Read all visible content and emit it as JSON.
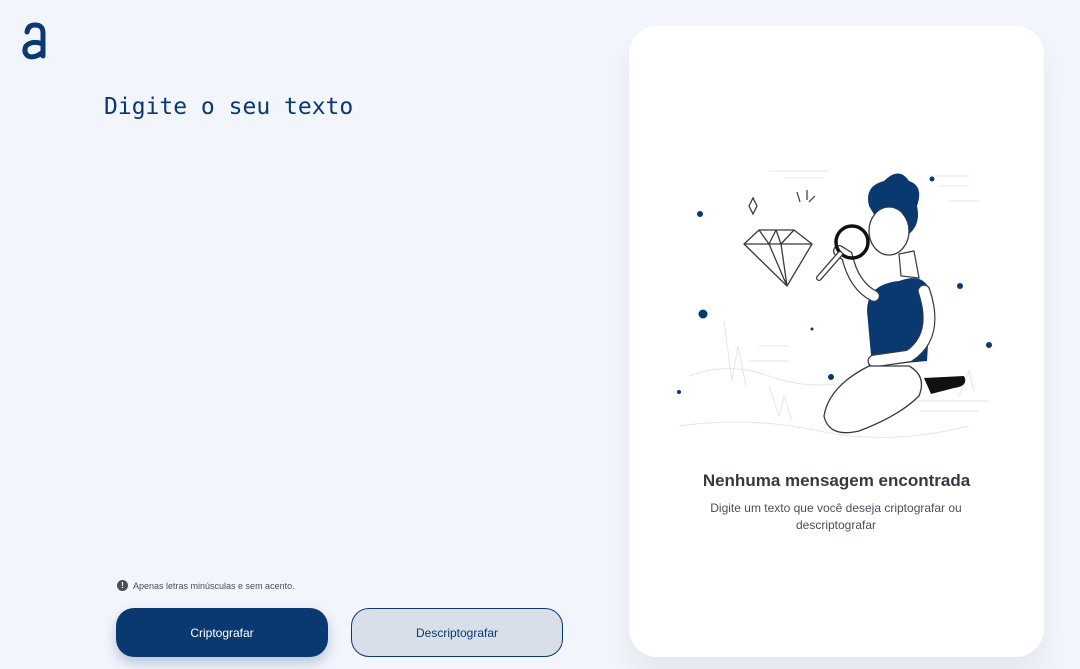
{
  "brand": {
    "logo_icon": "alura-a-logo-icon",
    "color": "#0a3871"
  },
  "editor": {
    "placeholder": "Digite o seu texto",
    "value": ""
  },
  "hint": {
    "icon": "info-circle-icon",
    "text": "Apenas letras minúsculas e sem acento."
  },
  "actions": {
    "encrypt_label": "Criptografar",
    "decrypt_label": "Descriptografar"
  },
  "output": {
    "illustration": "person-with-magnifying-glass-illustration",
    "title": "Nenhuma mensagem encontrada",
    "description": "Digite um texto que você deseja criptografar ou descriptografar"
  },
  "colors": {
    "background": "#f2f5fc",
    "primary": "#0a3871",
    "secondary_bg": "#d8dfe8",
    "card": "#ffffff"
  }
}
